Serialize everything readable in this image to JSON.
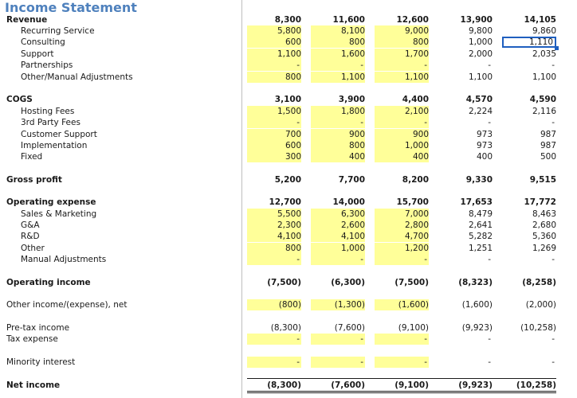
{
  "title": "Income Statement",
  "rows": [
    {
      "label": "Revenue",
      "bold": true,
      "level": 0,
      "values": [
        "8,300",
        "11,600",
        "12,600",
        "13,900",
        "14,105"
      ],
      "hl": false
    },
    {
      "label": "Recurring Service",
      "bold": false,
      "level": 1,
      "values": [
        "5,800",
        "8,100",
        "9,000",
        "9,800",
        "9,860"
      ],
      "hl": true
    },
    {
      "label": "Consulting",
      "bold": false,
      "level": 1,
      "values": [
        "600",
        "800",
        "800",
        "1,000",
        "1,110"
      ],
      "hl": true
    },
    {
      "label": "Support",
      "bold": false,
      "level": 1,
      "values": [
        "1,100",
        "1,600",
        "1,700",
        "2,000",
        "2,035"
      ],
      "hl": true
    },
    {
      "label": "Partnerships",
      "bold": false,
      "level": 1,
      "values": [
        "-",
        "-",
        "-",
        "-",
        "-"
      ],
      "hl": true
    },
    {
      "label": "Other/Manual Adjustments",
      "bold": false,
      "level": 1,
      "values": [
        "800",
        "1,100",
        "1,100",
        "1,100",
        "1,100"
      ],
      "hl": true
    },
    {
      "label": "COGS",
      "bold": true,
      "level": 0,
      "values": [
        "3,100",
        "3,900",
        "4,400",
        "4,570",
        "4,590"
      ],
      "hl": false
    },
    {
      "label": "Hosting Fees",
      "bold": false,
      "level": 1,
      "values": [
        "1,500",
        "1,800",
        "2,100",
        "2,224",
        "2,116"
      ],
      "hl": true
    },
    {
      "label": "3rd Party Fees",
      "bold": false,
      "level": 1,
      "values": [
        "-",
        "-",
        "-",
        "-",
        "-"
      ],
      "hl": true
    },
    {
      "label": "Customer Support",
      "bold": false,
      "level": 1,
      "values": [
        "700",
        "900",
        "900",
        "973",
        "987"
      ],
      "hl": true
    },
    {
      "label": "Implementation",
      "bold": false,
      "level": 1,
      "values": [
        "600",
        "800",
        "1,000",
        "973",
        "987"
      ],
      "hl": true
    },
    {
      "label": "Fixed",
      "bold": false,
      "level": 1,
      "values": [
        "300",
        "400",
        "400",
        "400",
        "500"
      ],
      "hl": true
    },
    {
      "label": "Gross profit",
      "bold": true,
      "level": 0,
      "values": [
        "5,200",
        "7,700",
        "8,200",
        "9,330",
        "9,515"
      ],
      "hl": false
    },
    {
      "label": "Operating expense",
      "bold": true,
      "level": 0,
      "values": [
        "12,700",
        "14,000",
        "15,700",
        "17,653",
        "17,772"
      ],
      "hl": false
    },
    {
      "label": "Sales & Marketing",
      "bold": false,
      "level": 1,
      "values": [
        "5,500",
        "6,300",
        "7,000",
        "8,479",
        "8,463"
      ],
      "hl": true
    },
    {
      "label": "G&A",
      "bold": false,
      "level": 1,
      "values": [
        "2,300",
        "2,600",
        "2,800",
        "2,641",
        "2,680"
      ],
      "hl": true
    },
    {
      "label": "R&D",
      "bold": false,
      "level": 1,
      "values": [
        "4,100",
        "4,100",
        "4,700",
        "5,282",
        "5,360"
      ],
      "hl": true
    },
    {
      "label": "Other",
      "bold": false,
      "level": 1,
      "values": [
        "800",
        "1,000",
        "1,200",
        "1,251",
        "1,269"
      ],
      "hl": true
    },
    {
      "label": "Manual Adjustments",
      "bold": false,
      "level": 1,
      "values": [
        "-",
        "-",
        "-",
        "-",
        "-"
      ],
      "hl": true
    },
    {
      "label": "Operating income",
      "bold": true,
      "level": 0,
      "values": [
        "(7,500)",
        "(6,300)",
        "(7,500)",
        "(8,323)",
        "(8,258)"
      ],
      "hl": false
    },
    {
      "label": "Other income/(expense), net",
      "bold": false,
      "level": 0,
      "values": [
        "(800)",
        "(1,300)",
        "(1,600)",
        "(1,600)",
        "(2,000)"
      ],
      "hl": true
    },
    {
      "label": "Pre-tax income",
      "bold": false,
      "level": 0,
      "values": [
        "(8,300)",
        "(7,600)",
        "(9,100)",
        "(9,923)",
        "(10,258)"
      ],
      "hl": false
    },
    {
      "label": "Tax expense",
      "bold": false,
      "level": 0,
      "values": [
        "-",
        "-",
        "-",
        "-",
        "-"
      ],
      "hl": true
    },
    {
      "label": "Minority interest",
      "bold": false,
      "level": 0,
      "values": [
        "-",
        "-",
        "-",
        "-",
        "-"
      ],
      "hl": true
    },
    {
      "label": "Net income",
      "bold": true,
      "level": 0,
      "values": [
        "(8,300)",
        "(7,600)",
        "(9,100)",
        "(9,923)",
        "(10,258)"
      ],
      "hl": false
    }
  ],
  "colors": {
    "highlight": "#ffff99",
    "title": "#4f81bd",
    "selection": "#1f5fbf"
  }
}
